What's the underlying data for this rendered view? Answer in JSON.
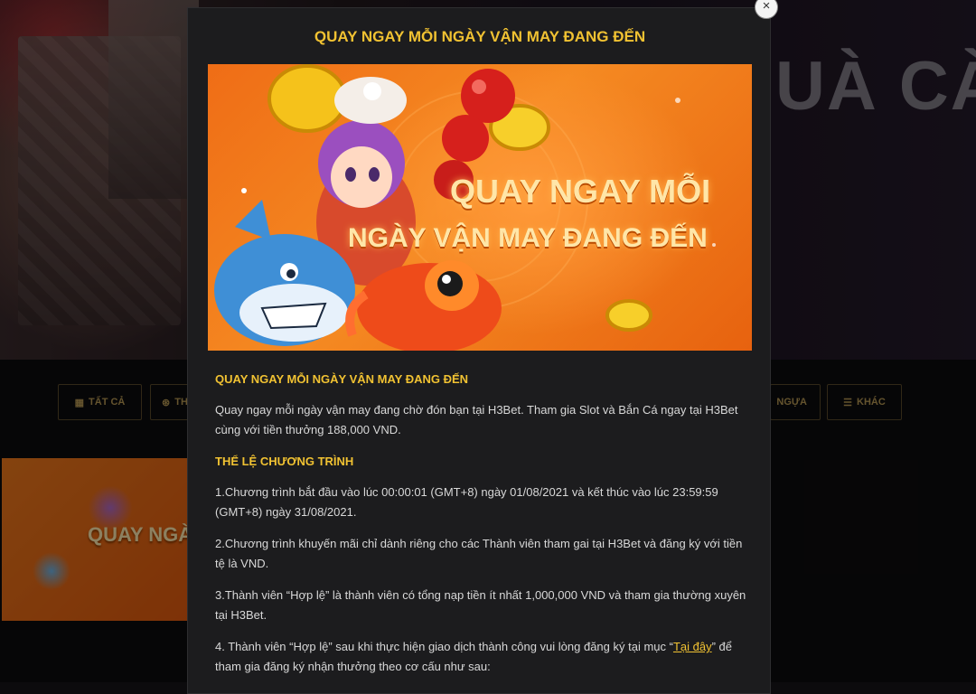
{
  "background": {
    "hero_title": "UÀ CÀ",
    "filters": [
      {
        "icon": "grid-icon",
        "label": "TẤT CẢ"
      },
      {
        "icon": "circle-icon",
        "label": "TH"
      },
      {
        "icon": "horse-icon",
        "label": "NGỰA"
      },
      {
        "icon": "list-icon",
        "label": "KHÁC"
      }
    ],
    "thumb_text": "QUAY NGÀY VẬN M"
  },
  "modal": {
    "title": "QUAY NGAY MỖI NGÀY VẬN MAY ĐANG ĐẾN",
    "close_label": "×",
    "banner": {
      "line1": "QUAY NGAY MỖI",
      "line2": "NGÀY VẬN MAY ĐANG ĐẾN"
    },
    "heading": "QUAY NGAY MỖI NGÀY VẬN MAY ĐANG ĐẾN",
    "intro": "Quay ngay mỗi ngày vận may đang chờ đón bạn tại H3Bet. Tham gia Slot và Bắn Cá ngay tại H3Bet cùng với tiền thưởng 188,000 VND.",
    "rules_heading": "THỂ LỆ CHƯƠNG TRÌNH",
    "rules": [
      "1.Chương trình bắt đầu vào lúc 00:00:01 (GMT+8) ngày 01/08/2021 và kết thúc vào lúc 23:59:59 (GMT+8) ngày 31/08/2021.",
      "2.Chương trình khuyến mãi chỉ dành riêng cho các Thành viên tham gai tại H3Bet và đăng ký với tiền tệ là VND.",
      "3.Thành viên “Hợp lệ” là thành viên có tổng nạp tiền ít nhất 1,000,000 VND và tham gia thường xuyên tại H3Bet."
    ],
    "rule4_before": "4. Thành viên “Hợp lệ” sau khi thực hiện giao dịch thành công vui lòng đăng ký tại mục “",
    "rule4_link": "Tại đây",
    "rule4_after": "” để tham gia đăng ký nhận thưởng theo cơ cấu như sau:"
  }
}
